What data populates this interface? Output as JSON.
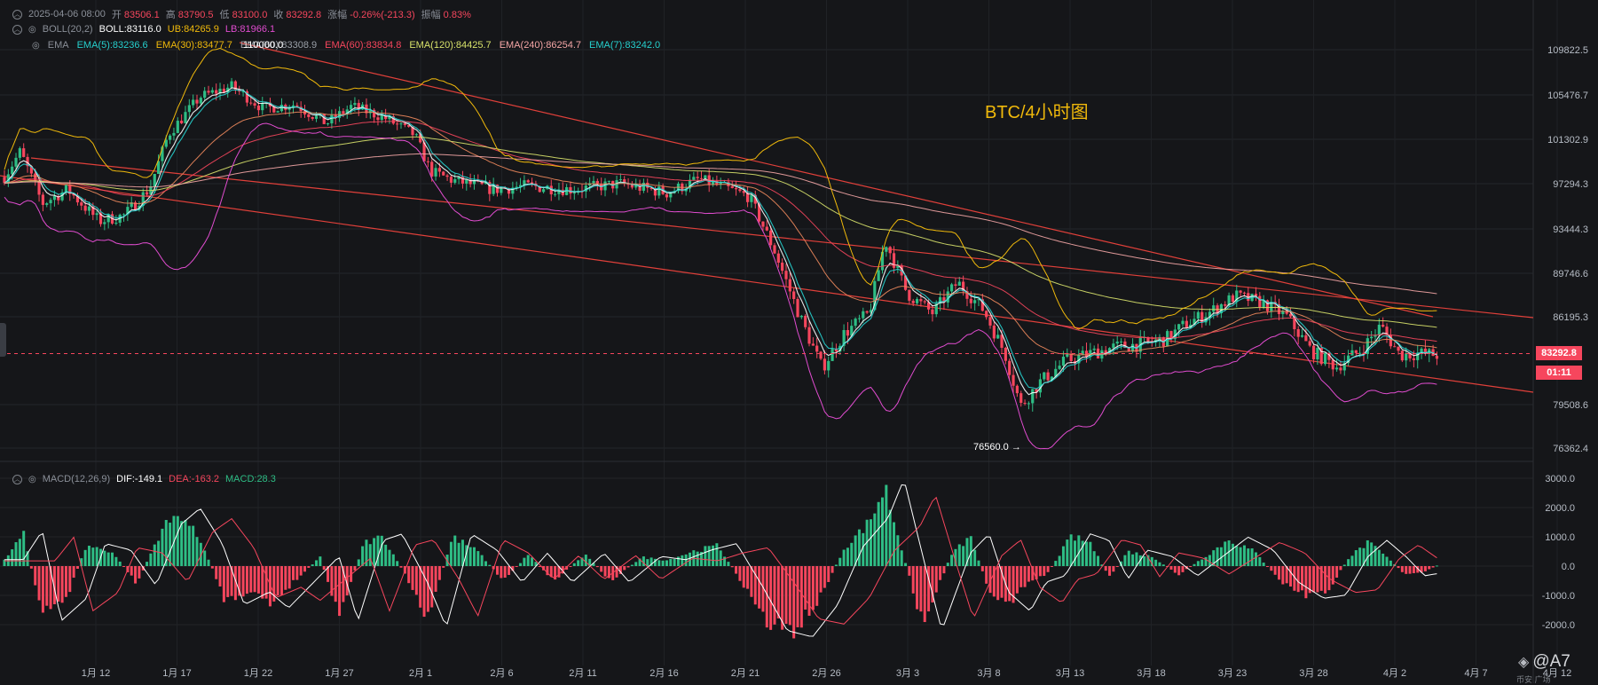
{
  "header": {
    "datetime": "2025-04-06 08:00",
    "open_label": "开",
    "open": "83506.1",
    "high_label": "高",
    "high": "83790.5",
    "low_label": "低",
    "low": "83100.0",
    "close_label": "收",
    "close": "83292.8",
    "change_label": "涨幅",
    "change": "-0.26%(-213.3)",
    "amplitude_label": "振幅",
    "amplitude": "0.83%"
  },
  "boll": {
    "label": "BOLL(20,2)",
    "mid": "BOLL:83116.0",
    "ub": "UB:84265.9",
    "lb": "LB:81966.1"
  },
  "ema_row": {
    "label": "EMA",
    "items": [
      {
        "text": "EMA(5):83236.6",
        "color": "#26d0ce"
      },
      {
        "text": "EMA(30):83477.7",
        "color": "#f0b90b"
      },
      {
        "text": "EMA(60):83308.9",
        "color": "#9aa0a8"
      },
      {
        "text": "EMA(60):83834.8",
        "color": "#f6465d"
      },
      {
        "text": "EMA(120):84425.7",
        "color": "#d8e26b"
      },
      {
        "text": "EMA(240):86254.7",
        "color": "#f4a6a6"
      },
      {
        "text": "EMA(7):83242.0",
        "color": "#26d0ce"
      }
    ],
    "overlap_label": "110000.0"
  },
  "macd": {
    "label": "MACD(12,26,9)",
    "dif": "DIF:-149.1",
    "dea": "DEA:-163.2",
    "value": "MACD:28.3"
  },
  "chart_title": "BTC/4小时图",
  "low_marker": "76560.0",
  "price_tag": "83292.8",
  "countdown_tag": "01:11",
  "watermark": "@A7",
  "watermark_sub": "币安 广场",
  "colors": {
    "background": "#151619",
    "up": "#2ebd85",
    "down": "#f6465d",
    "trendline": "#e0403a",
    "title": "#f0b90b"
  },
  "chart_data": [
    {
      "type": "line",
      "title": "BTC/4小时图",
      "series": [
        {
          "name": "EMA(5):83236.6"
        },
        {
          "name": "EMA(30):83477.7"
        },
        {
          "name": "EMA(60):83834.8"
        },
        {
          "name": "EMA(120):84425.7"
        },
        {
          "name": "EMA(240):86254.7"
        },
        {
          "name": "UB:84265.9"
        },
        {
          "name": "LB:81966.1"
        }
      ],
      "x_ticks": [
        "1月 12",
        "1月 17",
        "1月 22",
        "1月 27",
        "2月 1",
        "2月 6",
        "2月 11",
        "2月 16",
        "2月 21",
        "2月 26",
        "3月 3",
        "3月 8",
        "3月 13",
        "3月 18",
        "3月 23",
        "3月 28",
        "4月 2",
        "4月 7",
        "4月 12"
      ],
      "y_ticks": [
        "109822.5",
        "105476.7",
        "101302.9",
        "97294.3",
        "93444.3",
        "89746.6",
        "86195.3",
        "79508.6",
        "76362.4"
      ],
      "ylim": [
        75500,
        112000
      ],
      "last_price": 83292.8,
      "annotated_low": 76560.0,
      "close_path": [
        {
          "t": 0.0,
          "v": 97900
        },
        {
          "t": 0.5,
          "v": 100200
        },
        {
          "t": 1.2,
          "v": 95600
        },
        {
          "t": 2.0,
          "v": 96800
        },
        {
          "t": 3.0,
          "v": 94100
        },
        {
          "t": 3.8,
          "v": 94600
        },
        {
          "t": 4.6,
          "v": 96900
        },
        {
          "t": 5.2,
          "v": 101800
        },
        {
          "t": 6.2,
          "v": 105300
        },
        {
          "t": 7.2,
          "v": 106300
        },
        {
          "t": 8.2,
          "v": 104200
        },
        {
          "t": 9.2,
          "v": 104600
        },
        {
          "t": 10.2,
          "v": 102800
        },
        {
          "t": 11.0,
          "v": 104400
        },
        {
          "t": 12.0,
          "v": 103400
        },
        {
          "t": 13.0,
          "v": 101700
        },
        {
          "t": 13.5,
          "v": 98400
        },
        {
          "t": 14.2,
          "v": 97600
        },
        {
          "t": 15.5,
          "v": 96800
        },
        {
          "t": 16.5,
          "v": 97100
        },
        {
          "t": 18.0,
          "v": 96800
        },
        {
          "t": 19.5,
          "v": 97300
        },
        {
          "t": 21.0,
          "v": 96500
        },
        {
          "t": 22.0,
          "v": 97700
        },
        {
          "t": 23.6,
          "v": 96200
        },
        {
          "t": 24.4,
          "v": 91600
        },
        {
          "t": 25.2,
          "v": 86200
        },
        {
          "t": 25.9,
          "v": 82300
        },
        {
          "t": 26.6,
          "v": 84900
        },
        {
          "t": 27.4,
          "v": 86500
        },
        {
          "t": 27.9,
          "v": 92500
        },
        {
          "t": 28.6,
          "v": 88100
        },
        {
          "t": 29.4,
          "v": 86500
        },
        {
          "t": 30.2,
          "v": 89000
        },
        {
          "t": 31.0,
          "v": 86800
        },
        {
          "t": 31.7,
          "v": 83400
        },
        {
          "t": 32.2,
          "v": 79400
        },
        {
          "t": 32.8,
          "v": 81200
        },
        {
          "t": 33.6,
          "v": 82800
        },
        {
          "t": 34.4,
          "v": 83400
        },
        {
          "t": 35.2,
          "v": 83900
        },
        {
          "t": 36.0,
          "v": 84100
        },
        {
          "t": 36.8,
          "v": 84500
        },
        {
          "t": 37.4,
          "v": 85600
        },
        {
          "t": 38.2,
          "v": 86600
        },
        {
          "t": 39.0,
          "v": 87900
        },
        {
          "t": 39.8,
          "v": 87400
        },
        {
          "t": 40.6,
          "v": 86300
        },
        {
          "t": 41.4,
          "v": 83600
        },
        {
          "t": 42.2,
          "v": 82400
        },
        {
          "t": 43.0,
          "v": 83700
        },
        {
          "t": 43.6,
          "v": 85500
        },
        {
          "t": 44.2,
          "v": 83300
        },
        {
          "t": 44.8,
          "v": 83400
        },
        {
          "t": 45.4,
          "v": 83292.8
        }
      ]
    },
    {
      "type": "bar",
      "title": "MACD(12,26,9)",
      "series": [
        {
          "name": "DIF:-149.1"
        },
        {
          "name": "DEA:-163.2"
        },
        {
          "name": "MACD:28.3"
        }
      ],
      "y_ticks": [
        "3000.0",
        "2000.0",
        "1000.0",
        "0.0",
        "-1000.0",
        "-2000.0"
      ],
      "ylim": [
        -3000,
        3200
      ],
      "hist_path": [
        {
          "t": 0.0,
          "v": 200
        },
        {
          "t": 0.6,
          "v": 1100
        },
        {
          "t": 1.2,
          "v": -1700
        },
        {
          "t": 2.0,
          "v": -1000
        },
        {
          "t": 2.6,
          "v": 700
        },
        {
          "t": 3.4,
          "v": 500
        },
        {
          "t": 4.2,
          "v": -600
        },
        {
          "t": 5.0,
          "v": 1300
        },
        {
          "t": 5.6,
          "v": 1800
        },
        {
          "t": 6.3,
          "v": 700
        },
        {
          "t": 7.0,
          "v": -1200
        },
        {
          "t": 7.8,
          "v": -800
        },
        {
          "t": 8.4,
          "v": -1300
        },
        {
          "t": 9.2,
          "v": -500
        },
        {
          "t": 10.0,
          "v": 300
        },
        {
          "t": 10.6,
          "v": -1700
        },
        {
          "t": 11.4,
          "v": 800
        },
        {
          "t": 12.0,
          "v": 1000
        },
        {
          "t": 12.8,
          "v": -500
        },
        {
          "t": 13.4,
          "v": -1900
        },
        {
          "t": 14.2,
          "v": 1000
        },
        {
          "t": 15.0,
          "v": 500
        },
        {
          "t": 15.8,
          "v": -500
        },
        {
          "t": 16.6,
          "v": 400
        },
        {
          "t": 17.4,
          "v": -500
        },
        {
          "t": 18.4,
          "v": 400
        },
        {
          "t": 19.2,
          "v": -500
        },
        {
          "t": 20.2,
          "v": 300
        },
        {
          "t": 21.0,
          "v": 200
        },
        {
          "t": 21.8,
          "v": 500
        },
        {
          "t": 22.6,
          "v": 700
        },
        {
          "t": 23.4,
          "v": -600
        },
        {
          "t": 24.2,
          "v": -2000
        },
        {
          "t": 25.0,
          "v": -2200
        },
        {
          "t": 25.8,
          "v": -1200
        },
        {
          "t": 26.6,
          "v": 600
        },
        {
          "t": 27.4,
          "v": 1500
        },
        {
          "t": 27.9,
          "v": 2700
        },
        {
          "t": 28.5,
          "v": 300
        },
        {
          "t": 29.1,
          "v": -2000
        },
        {
          "t": 30.0,
          "v": 400
        },
        {
          "t": 30.6,
          "v": 1000
        },
        {
          "t": 31.2,
          "v": -800
        },
        {
          "t": 31.9,
          "v": -1400
        },
        {
          "t": 32.4,
          "v": -500
        },
        {
          "t": 33.0,
          "v": -300
        },
        {
          "t": 33.8,
          "v": 1000
        },
        {
          "t": 34.4,
          "v": 800
        },
        {
          "t": 35.0,
          "v": -400
        },
        {
          "t": 35.6,
          "v": 500
        },
        {
          "t": 36.4,
          "v": 300
        },
        {
          "t": 37.2,
          "v": -300
        },
        {
          "t": 38.0,
          "v": 300
        },
        {
          "t": 38.8,
          "v": 900
        },
        {
          "t": 39.6,
          "v": 500
        },
        {
          "t": 40.4,
          "v": -500
        },
        {
          "t": 41.2,
          "v": -1000
        },
        {
          "t": 41.9,
          "v": -900
        },
        {
          "t": 42.6,
          "v": 300
        },
        {
          "t": 43.2,
          "v": 800
        },
        {
          "t": 43.8,
          "v": 300
        },
        {
          "t": 44.4,
          "v": -300
        },
        {
          "t": 45.0,
          "v": -200
        },
        {
          "t": 45.4,
          "v": 28
        }
      ]
    }
  ]
}
